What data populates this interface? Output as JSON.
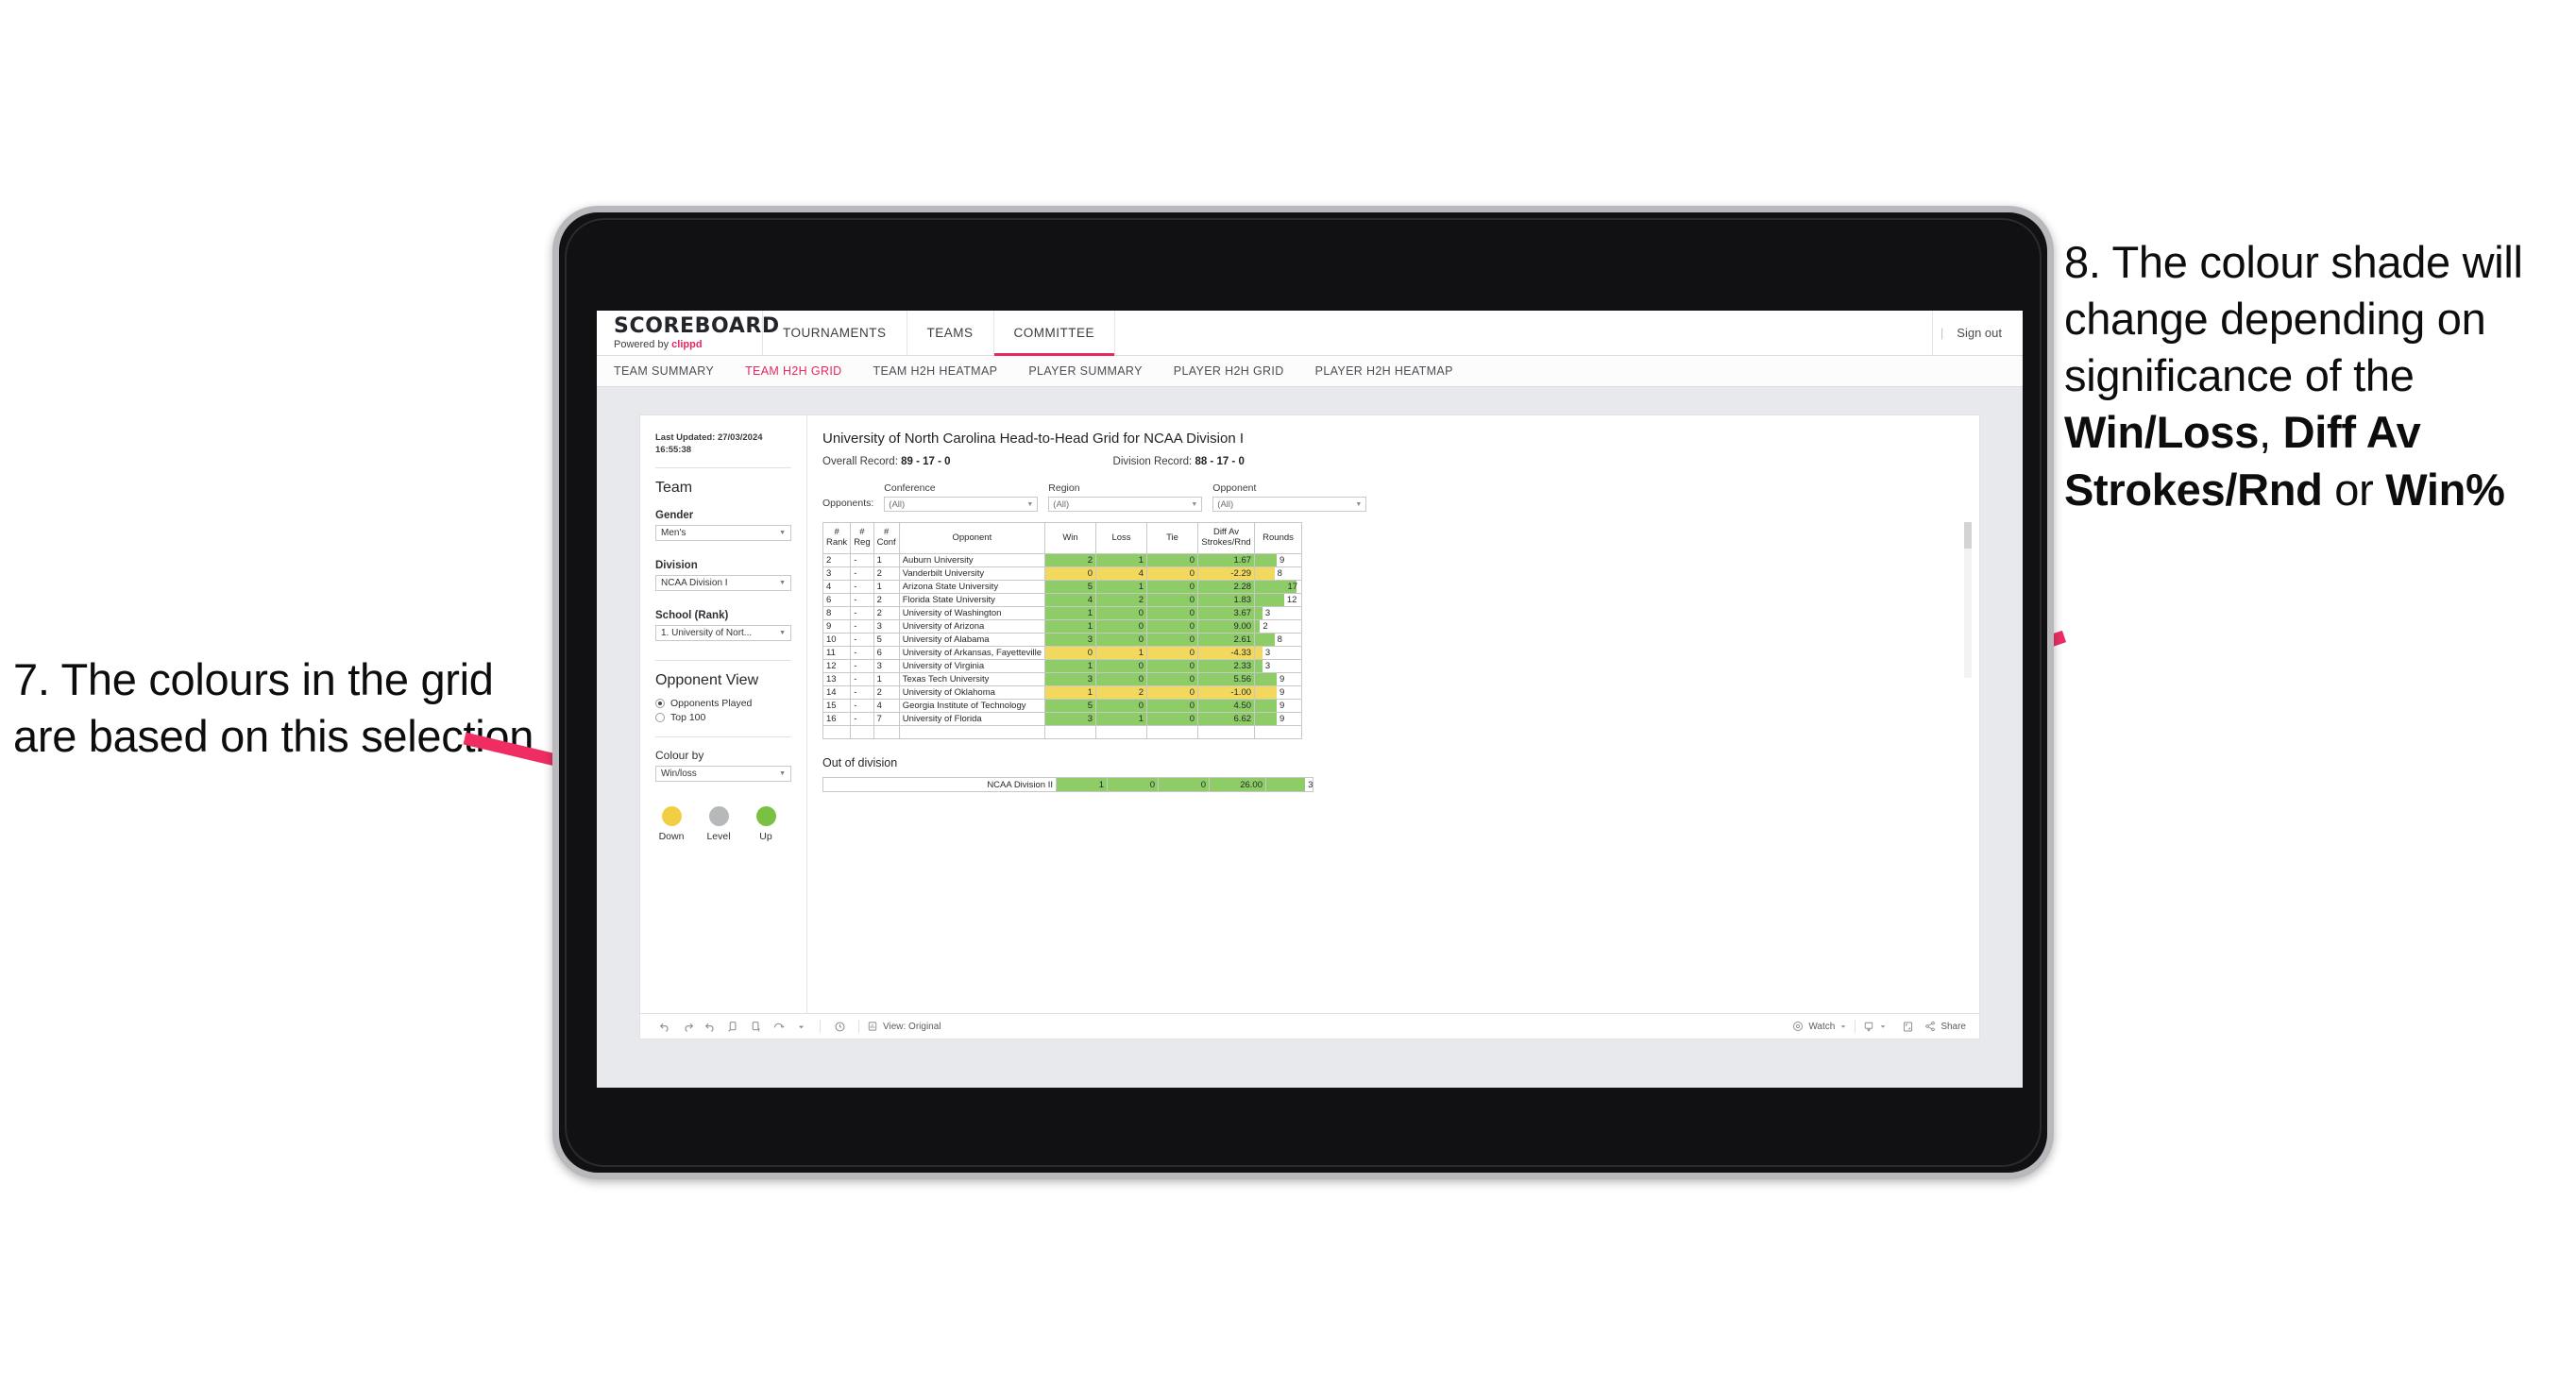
{
  "annotations": {
    "left": "7. The colours in the grid are based on this selection",
    "right_pre": "8. The colour shade will change depending on significance of the ",
    "right_b1": "Win/Loss",
    "right_mid1": ", ",
    "right_b2": "Diff Av Strokes/Rnd",
    "right_mid2": " or ",
    "right_b3": "Win%",
    "arrow_color": "#ef2d63"
  },
  "header": {
    "brand_title": "SCOREBOARD",
    "brand_sub_pre": "Powered by ",
    "brand_sub_brand": "clippd",
    "nav": [
      {
        "label": "TOURNAMENTS",
        "active": false
      },
      {
        "label": "TEAMS",
        "active": false
      },
      {
        "label": "COMMITTEE",
        "active": true
      }
    ],
    "signout_divider": "|",
    "signout": "Sign out",
    "accent": "#e8285f"
  },
  "subnav": [
    {
      "label": "TEAM SUMMARY",
      "active": false
    },
    {
      "label": "TEAM H2H GRID",
      "active": true
    },
    {
      "label": "TEAM H2H HEATMAP",
      "active": false
    },
    {
      "label": "PLAYER SUMMARY",
      "active": false
    },
    {
      "label": "PLAYER H2H GRID",
      "active": false
    },
    {
      "label": "PLAYER H2H HEATMAP",
      "active": false
    }
  ],
  "filters": {
    "last_updated": "Last Updated: 27/03/2024 16:55:38",
    "team_heading": "Team",
    "gender_label": "Gender",
    "gender_value": "Men's",
    "division_label": "Division",
    "division_value": "NCAA Division I",
    "school_label": "School (Rank)",
    "school_value": "1. University of Nort...",
    "opponent_view_heading": "Opponent View",
    "opponent_view_options": [
      {
        "label": "Opponents Played",
        "selected": true
      },
      {
        "label": "Top 100",
        "selected": false
      }
    ],
    "colour_by_label": "Colour by",
    "colour_by_value": "Win/loss",
    "legend": [
      {
        "label": "Down",
        "color": "#f2cf42"
      },
      {
        "label": "Level",
        "color": "#b6b8ba"
      },
      {
        "label": "Up",
        "color": "#7ac143"
      }
    ]
  },
  "main": {
    "title": "University of North Carolina Head-to-Head Grid for NCAA Division I",
    "overall_record_label": "Overall Record: ",
    "overall_record_value": "89 - 17 - 0",
    "division_record_label": "Division Record: ",
    "division_record_value": "88 - 17 - 0",
    "opponents_label": "Opponents:",
    "opponent_filters": [
      {
        "title": "Conference",
        "value": "(All)"
      },
      {
        "title": "Region",
        "value": "(All)"
      },
      {
        "title": "Opponent",
        "value": "(All)"
      }
    ],
    "columns": [
      "# Rank",
      "# Reg",
      "# Conf",
      "Opponent",
      "Win",
      "Loss",
      "Tie",
      "Diff Av Strokes/Rnd",
      "Rounds"
    ],
    "column_headers": {
      "rank_l1": "#",
      "rank_l2": "Rank",
      "reg_l1": "#",
      "reg_l2": "Reg",
      "conf_l1": "#",
      "conf_l2": "Conf",
      "opponent": "Opponent",
      "win": "Win",
      "loss": "Loss",
      "tie": "Tie",
      "diff_l1": "Diff Av",
      "diff_l2": "Strokes/Rnd",
      "rounds": "Rounds"
    },
    "rows": [
      {
        "rank": "2",
        "reg": "-",
        "conf": "1",
        "opponent": "Auburn University",
        "win": "2",
        "loss": "1",
        "tie": "0",
        "diff": "1.67",
        "rounds": "9",
        "rounds_pct": 47,
        "color": "#8dcc67"
      },
      {
        "rank": "3",
        "reg": "-",
        "conf": "2",
        "opponent": "Vanderbilt University",
        "win": "0",
        "loss": "4",
        "tie": "0",
        "diff": "-2.29",
        "rounds": "8",
        "rounds_pct": 42,
        "color": "#f2d95e"
      },
      {
        "rank": "4",
        "reg": "-",
        "conf": "1",
        "opponent": "Arizona State University",
        "win": "5",
        "loss": "1",
        "tie": "0",
        "diff": "2.28",
        "rounds": "17",
        "rounds_pct": 89,
        "color": "#8dcc67"
      },
      {
        "rank": "6",
        "reg": "-",
        "conf": "2",
        "opponent": "Florida State University",
        "win": "4",
        "loss": "2",
        "tie": "0",
        "diff": "1.83",
        "rounds": "12",
        "rounds_pct": 63,
        "color": "#8dcc67"
      },
      {
        "rank": "8",
        "reg": "-",
        "conf": "2",
        "opponent": "University of Washington",
        "win": "1",
        "loss": "0",
        "tie": "0",
        "diff": "3.67",
        "rounds": "3",
        "rounds_pct": 16,
        "color": "#8dcc67"
      },
      {
        "rank": "9",
        "reg": "-",
        "conf": "3",
        "opponent": "University of Arizona",
        "win": "1",
        "loss": "0",
        "tie": "0",
        "diff": "9.00",
        "rounds": "2",
        "rounds_pct": 11,
        "color": "#8dcc67"
      },
      {
        "rank": "10",
        "reg": "-",
        "conf": "5",
        "opponent": "University of Alabama",
        "win": "3",
        "loss": "0",
        "tie": "0",
        "diff": "2.61",
        "rounds": "8",
        "rounds_pct": 42,
        "color": "#8dcc67"
      },
      {
        "rank": "11",
        "reg": "-",
        "conf": "6",
        "opponent": "University of Arkansas, Fayetteville",
        "win": "0",
        "loss": "1",
        "tie": "0",
        "diff": "-4.33",
        "rounds": "3",
        "rounds_pct": 16,
        "color": "#f2d95e"
      },
      {
        "rank": "12",
        "reg": "-",
        "conf": "3",
        "opponent": "University of Virginia",
        "win": "1",
        "loss": "0",
        "tie": "0",
        "diff": "2.33",
        "rounds": "3",
        "rounds_pct": 16,
        "color": "#8dcc67"
      },
      {
        "rank": "13",
        "reg": "-",
        "conf": "1",
        "opponent": "Texas Tech University",
        "win": "3",
        "loss": "0",
        "tie": "0",
        "diff": "5.56",
        "rounds": "9",
        "rounds_pct": 47,
        "color": "#8dcc67"
      },
      {
        "rank": "14",
        "reg": "-",
        "conf": "2",
        "opponent": "University of Oklahoma",
        "win": "1",
        "loss": "2",
        "tie": "0",
        "diff": "-1.00",
        "rounds": "9",
        "rounds_pct": 47,
        "color": "#f2d95e"
      },
      {
        "rank": "15",
        "reg": "-",
        "conf": "4",
        "opponent": "Georgia Institute of Technology",
        "win": "5",
        "loss": "0",
        "tie": "0",
        "diff": "4.50",
        "rounds": "9",
        "rounds_pct": 47,
        "color": "#8dcc67"
      },
      {
        "rank": "16",
        "reg": "-",
        "conf": "7",
        "opponent": "University of Florida",
        "win": "3",
        "loss": "1",
        "tie": "0",
        "diff": "6.62",
        "rounds": "9",
        "rounds_pct": 47,
        "color": "#8dcc67"
      }
    ],
    "out_of_division_title": "Out of division",
    "out_of_division_row": {
      "name": "NCAA Division II",
      "win": "1",
      "loss": "0",
      "tie": "0",
      "diff": "26.00",
      "rounds": "3",
      "rounds_pct": 84,
      "color": "#8dcc67"
    }
  },
  "toolbar": {
    "buttons": [
      {
        "name": "undo-icon"
      },
      {
        "name": "redo-icon"
      },
      {
        "name": "revert-icon"
      },
      {
        "name": "refresh-icon"
      },
      {
        "name": "pause-icon"
      },
      {
        "name": "share-view-icon"
      },
      {
        "name": "chevron-down-icon"
      }
    ],
    "alerts_label": "",
    "view_label": "View: Original",
    "watch_label": "Watch",
    "share_label": "Share"
  }
}
